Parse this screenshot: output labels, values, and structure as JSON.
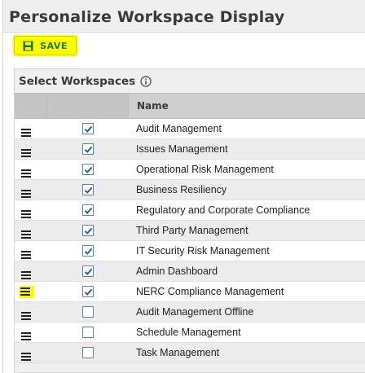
{
  "page": {
    "title": "Personalize Workspace Display"
  },
  "toolbar": {
    "save_label": "SAVE",
    "save_icon": "save-icon",
    "highlight_color": "#ffff00"
  },
  "section": {
    "title": "Select Workspaces",
    "info_icon": "info-icon"
  },
  "table": {
    "columns": [
      "",
      "",
      "Name"
    ],
    "rows": [
      {
        "name": "Audit Management",
        "checked": true,
        "highlighted": false
      },
      {
        "name": "Issues Management",
        "checked": true,
        "highlighted": false
      },
      {
        "name": "Operational Risk Management",
        "checked": true,
        "highlighted": false
      },
      {
        "name": "Business Resiliency",
        "checked": true,
        "highlighted": false
      },
      {
        "name": "Regulatory and Corporate Compliance",
        "checked": true,
        "highlighted": false
      },
      {
        "name": "Third Party Management",
        "checked": true,
        "highlighted": false
      },
      {
        "name": "IT Security Risk Management",
        "checked": true,
        "highlighted": false
      },
      {
        "name": "Admin Dashboard",
        "checked": true,
        "highlighted": false
      },
      {
        "name": "NERC Compliance Management",
        "checked": true,
        "highlighted": true
      },
      {
        "name": "Audit Management Offline",
        "checked": false,
        "highlighted": false
      },
      {
        "name": "Schedule Management",
        "checked": false,
        "highlighted": false
      },
      {
        "name": "Task Management",
        "checked": false,
        "highlighted": false
      }
    ]
  },
  "colors": {
    "checkbox_border": "#5a86b8",
    "checkmark": "#2b5f9e",
    "save_text": "#1e7a2e"
  }
}
